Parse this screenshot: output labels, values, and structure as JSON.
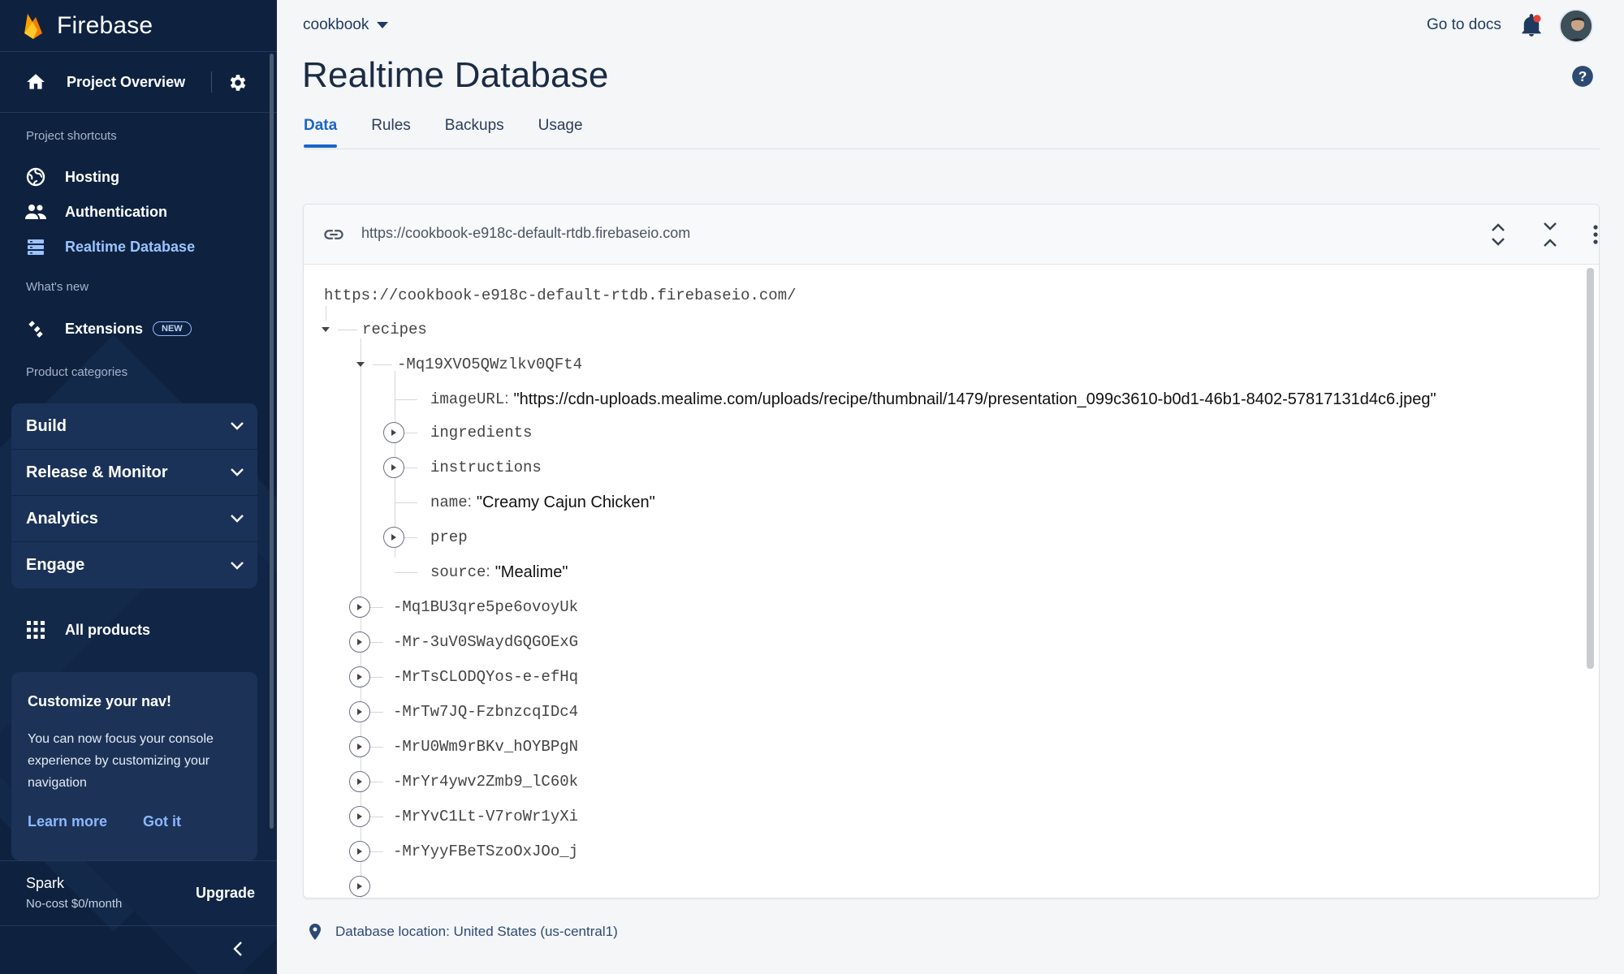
{
  "sidebar": {
    "brand": "Firebase",
    "overview_label": "Project Overview",
    "shortcuts_heading": "Project shortcuts",
    "shortcuts": [
      {
        "label": "Hosting",
        "icon": "globe-icon"
      },
      {
        "label": "Authentication",
        "icon": "people-icon"
      },
      {
        "label": "Realtime Database",
        "icon": "database-icon",
        "active": true
      }
    ],
    "whats_new_heading": "What's new",
    "extensions_label": "Extensions",
    "new_badge": "NEW",
    "categories_heading": "Product categories",
    "categories": [
      "Build",
      "Release & Monitor",
      "Analytics",
      "Engage"
    ],
    "all_products_label": "All products",
    "promo": {
      "title": "Customize your nav!",
      "body": "You can now focus your console experience by customizing your navigation",
      "learn_more": "Learn more",
      "got_it": "Got it"
    },
    "plan": {
      "name": "Spark",
      "desc": "No-cost $0/month",
      "upgrade": "Upgrade"
    }
  },
  "header": {
    "project": "cookbook",
    "docs_link": "Go to docs",
    "title": "Realtime Database"
  },
  "tabs": [
    "Data",
    "Rules",
    "Backups",
    "Usage"
  ],
  "database": {
    "header_url": "https://cookbook-e918c-default-rtdb.firebaseio.com",
    "root_url": "https://cookbook-e918c-default-rtdb.firebaseio.com/",
    "recipes_key": "recipes",
    "expanded_key": "-Mq19XVO5QWzlkv0QFt4",
    "fields": {
      "imageURL_key": "imageURL",
      "imageURL_value": "\"https://cdn-uploads.mealime.com/uploads/recipe/thumbnail/1479/presentation_099c3610-b0d1-46b1-8402-57817131d4c6.jpeg\"",
      "ingredients_key": "ingredients",
      "instructions_key": "instructions",
      "name_key": "name",
      "name_value": "\"Creamy Cajun Chicken\"",
      "prep_key": "prep",
      "source_key": "source",
      "source_value": "\"Mealime\""
    },
    "collapsed_keys": [
      "-Mq1BU3qre5pe6ovoyUk",
      "-Mr-3uV0SWaydGQGOExG",
      "-MrTsCLODQYos-e-efHq",
      "-MrTw7JQ-FzbnzcqIDc4",
      "-MrU0Wm9rBKv_hOYBPgN",
      "-MrYr4ywv2Zmb9_lC60k",
      "-MrYvC1Lt-V7roWr1yXi",
      "-MrYyyFBeTSzoOxJOo_j"
    ],
    "location": "Database location: United States (us-central1)"
  },
  "colors": {
    "sidebar_bg": "#0e2240",
    "accent": "#1a64c8",
    "active_nav": "#9bc3ff"
  }
}
